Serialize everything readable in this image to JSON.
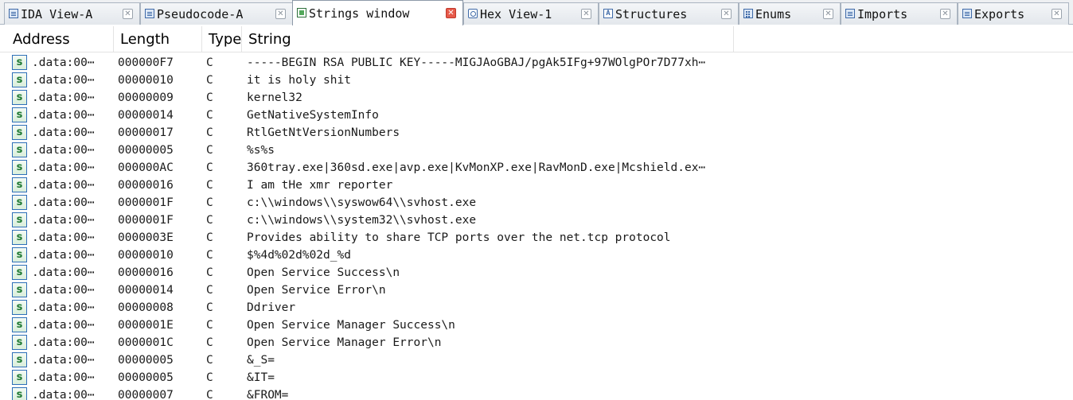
{
  "tabs": [
    {
      "label": "IDA View-A",
      "icon": "ida-view-icon",
      "active": false
    },
    {
      "label": "Pseudocode-A",
      "icon": "pseudocode-icon",
      "active": false
    },
    {
      "label": "Strings window",
      "icon": "strings-icon",
      "active": true
    },
    {
      "label": "Hex View-1",
      "icon": "hex-view-icon",
      "active": false
    },
    {
      "label": "Structures",
      "icon": "structures-icon",
      "active": false
    },
    {
      "label": "Enums",
      "icon": "enums-icon",
      "active": false
    },
    {
      "label": "Imports",
      "icon": "imports-icon",
      "active": false
    },
    {
      "label": "Exports",
      "icon": "exports-icon",
      "active": false
    }
  ],
  "close_glyph": "✕",
  "columns": {
    "address": "Address",
    "length": "Length",
    "type": "Type",
    "string": "String"
  },
  "row_icon_glyph": "s",
  "rows": [
    {
      "address": ".data:00⋯",
      "length": "000000F7",
      "type": "C",
      "string": "-----BEGIN RSA PUBLIC KEY-----MIGJAoGBAJ/pgAk5IFg+97WOlgPOr7D77xh⋯"
    },
    {
      "address": ".data:00⋯",
      "length": "00000010",
      "type": "C",
      "string": "it is holy shit"
    },
    {
      "address": ".data:00⋯",
      "length": "00000009",
      "type": "C",
      "string": "kernel32"
    },
    {
      "address": ".data:00⋯",
      "length": "00000014",
      "type": "C",
      "string": "GetNativeSystemInfo"
    },
    {
      "address": ".data:00⋯",
      "length": "00000017",
      "type": "C",
      "string": "RtlGetNtVersionNumbers"
    },
    {
      "address": ".data:00⋯",
      "length": "00000005",
      "type": "C",
      "string": "%s%s"
    },
    {
      "address": ".data:00⋯",
      "length": "000000AC",
      "type": "C",
      "string": "360tray.exe|360sd.exe|avp.exe|KvMonXP.exe|RavMonD.exe|Mcshield.ex⋯"
    },
    {
      "address": ".data:00⋯",
      "length": "00000016",
      "type": "C",
      "string": "I am tHe xmr reporter"
    },
    {
      "address": ".data:00⋯",
      "length": "0000001F",
      "type": "C",
      "string": "c:\\\\windows\\\\syswow64\\\\svhost.exe"
    },
    {
      "address": ".data:00⋯",
      "length": "0000001F",
      "type": "C",
      "string": "c:\\\\windows\\\\system32\\\\svhost.exe"
    },
    {
      "address": ".data:00⋯",
      "length": "0000003E",
      "type": "C",
      "string": "Provides ability to share TCP ports over the net.tcp protocol"
    },
    {
      "address": ".data:00⋯",
      "length": "00000010",
      "type": "C",
      "string": "$%4d%02d%02d_%d"
    },
    {
      "address": ".data:00⋯",
      "length": "00000016",
      "type": "C",
      "string": "Open Service Success\\n"
    },
    {
      "address": ".data:00⋯",
      "length": "00000014",
      "type": "C",
      "string": "Open Service Error\\n"
    },
    {
      "address": ".data:00⋯",
      "length": "00000008",
      "type": "C",
      "string": "Ddriver"
    },
    {
      "address": ".data:00⋯",
      "length": "0000001E",
      "type": "C",
      "string": "Open Service Manager Success\\n"
    },
    {
      "address": ".data:00⋯",
      "length": "0000001C",
      "type": "C",
      "string": "Open Service Manager Error\\n"
    },
    {
      "address": ".data:00⋯",
      "length": "00000005",
      "type": "C",
      "string": "&_S="
    },
    {
      "address": ".data:00⋯",
      "length": "00000005",
      "type": "C",
      "string": "&IT="
    },
    {
      "address": ".data:00⋯",
      "length": "00000007",
      "type": "C",
      "string": "&FROM="
    }
  ]
}
